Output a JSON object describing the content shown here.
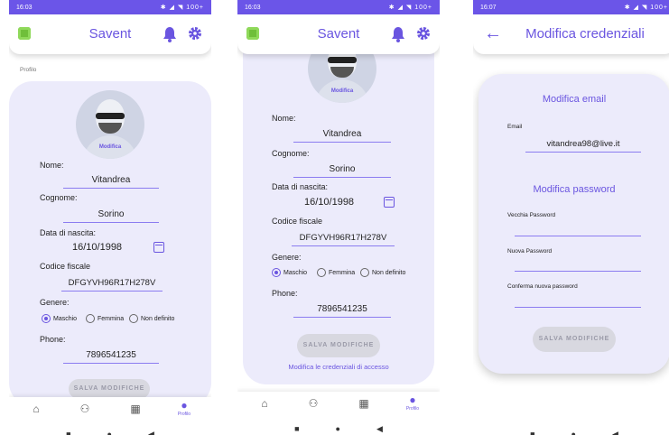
{
  "status": {
    "time1": "16:03",
    "time2": "16:03",
    "time3": "16:07",
    "right": "✱ ◢ ◥ 100+"
  },
  "app": {
    "title": "Savent"
  },
  "profile": {
    "breadcrumb": "Profilo",
    "avatar_edit": "Modifica",
    "nome_label": "Nome:",
    "nome": "Vitandrea",
    "cognome_label": "Cognome:",
    "cognome": "Sorino",
    "nascita_label": "Data di nascita:",
    "nascita": "16/10/1998",
    "cf_label": "Codice fiscale",
    "cf": "DFGYVH96R17H278V",
    "genere_label": "Genere:",
    "genere_options": [
      "Maschio",
      "Femmina",
      "Non definito"
    ],
    "phone_label": "Phone:",
    "phone": "7896541235",
    "save": "SALVA MODIFICHE",
    "cred_link": "Modifica le credenziali di accesso"
  },
  "nav": {
    "profilo": "Profilo"
  },
  "cred": {
    "title": "Modifica credenziali",
    "email_section": "Modifica email",
    "email_label": "Email",
    "email": "vitandrea98@live.it",
    "pwd_section": "Modifica password",
    "old_pwd": "Vecchia Password",
    "new_pwd": "Nuova Password",
    "confirm_pwd": "Conferma nuova password",
    "save": "SALVA MODIFICHE"
  },
  "colors": {
    "accent": "#6a55e0",
    "statusbar": "#6b55e8",
    "card": "#ecebfb"
  }
}
